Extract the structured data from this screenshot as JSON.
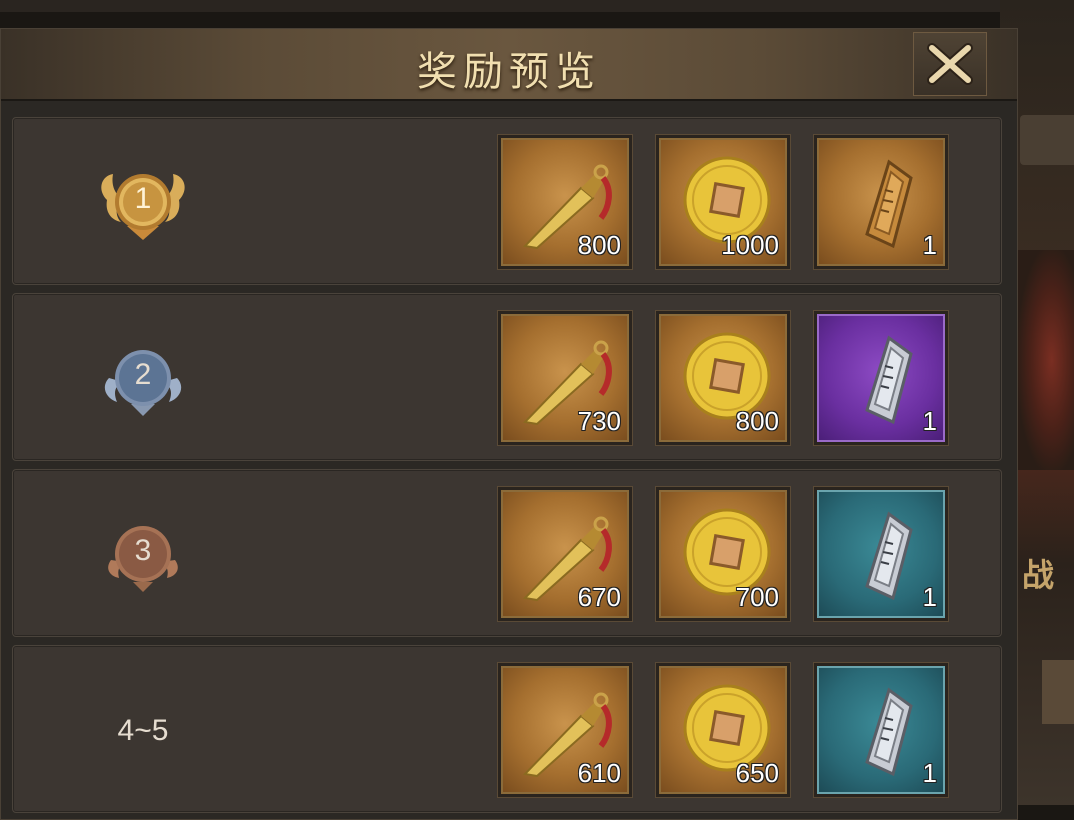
{
  "panel": {
    "title": "奖励预览",
    "close_icon": "close-icon"
  },
  "rows": [
    {
      "rank": "1",
      "rank_style": "gold-medal",
      "items": [
        {
          "icon": "dagger-icon",
          "qty": "800",
          "frame": "gold"
        },
        {
          "icon": "coin-icon",
          "qty": "1000",
          "frame": "gold"
        },
        {
          "icon": "token-icon",
          "qty": "1",
          "frame": "gold"
        }
      ]
    },
    {
      "rank": "2",
      "rank_style": "silver-medal",
      "items": [
        {
          "icon": "dagger-icon",
          "qty": "730",
          "frame": "gold"
        },
        {
          "icon": "coin-icon",
          "qty": "800",
          "frame": "gold"
        },
        {
          "icon": "token-icon",
          "qty": "1",
          "frame": "purple"
        }
      ]
    },
    {
      "rank": "3",
      "rank_style": "bronze-medal",
      "items": [
        {
          "icon": "dagger-icon",
          "qty": "670",
          "frame": "gold"
        },
        {
          "icon": "coin-icon",
          "qty": "700",
          "frame": "gold"
        },
        {
          "icon": "token-icon",
          "qty": "1",
          "frame": "teal"
        }
      ]
    },
    {
      "rank": "4~5",
      "rank_style": "plain",
      "items": [
        {
          "icon": "dagger-icon",
          "qty": "610",
          "frame": "gold"
        },
        {
          "icon": "coin-icon",
          "qty": "650",
          "frame": "gold"
        },
        {
          "icon": "token-icon",
          "qty": "1",
          "frame": "teal"
        }
      ]
    }
  ],
  "colors": {
    "gold_medal": "#c9a24c",
    "silver_medal": "#5c7494",
    "bronze_medal": "#8a5a44",
    "title": "#f1dfb0"
  },
  "side_text": "战"
}
